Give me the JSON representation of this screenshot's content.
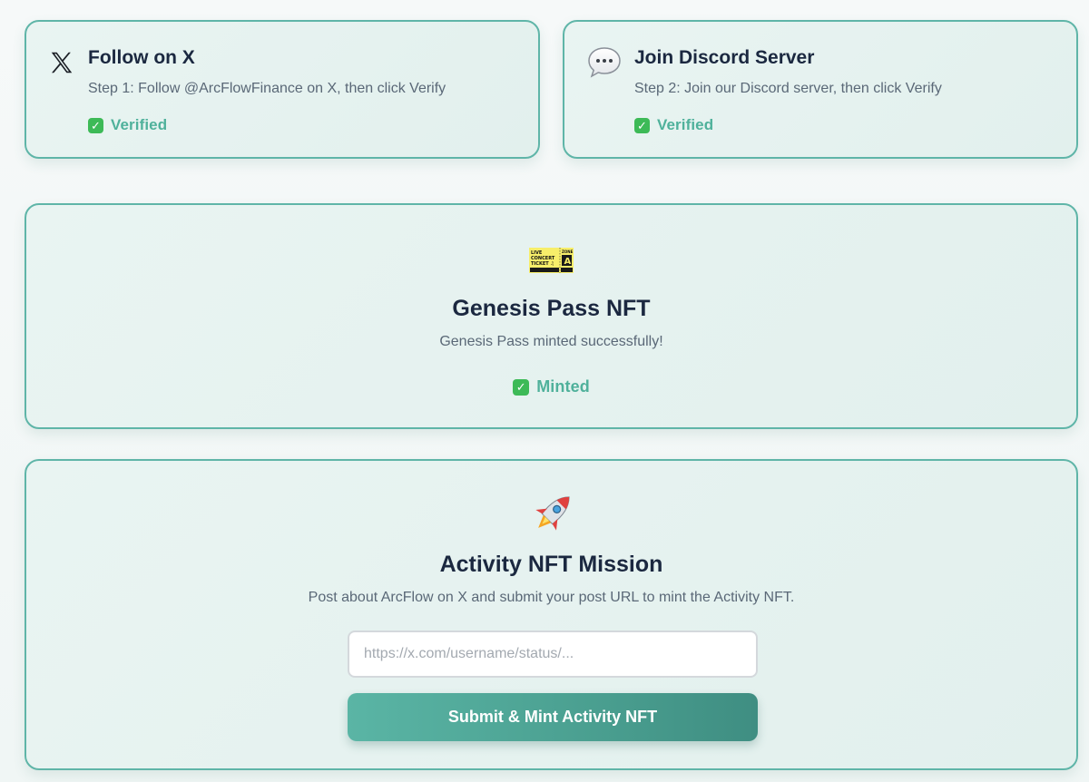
{
  "tasks": [
    {
      "icon": "x-logo-icon",
      "title": "Follow on X",
      "description": "Step 1: Follow @ArcFlowFinance on X, then click Verify",
      "status": "Verified"
    },
    {
      "icon": "speech-bubble-icon",
      "title": "Join Discord Server",
      "description": "Step 2: Join our Discord server, then click Verify",
      "status": "Verified"
    }
  ],
  "genesis": {
    "icon": "ticket-icon",
    "ticket_lines": [
      "LIVE",
      "CONCERT",
      "TICKET ♫",
      "ZONE",
      "A"
    ],
    "title": "Genesis Pass NFT",
    "description": "Genesis Pass minted successfully!",
    "status": "Minted"
  },
  "activity": {
    "icon": "rocket-icon",
    "title": "Activity NFT Mission",
    "description": "Post about ArcFlow on X and submit your post URL to mint the Activity NFT.",
    "input_placeholder": "https://x.com/username/status/...",
    "input_value": "",
    "button_label": "Submit & Mint Activity NFT"
  },
  "colors": {
    "accent": "#5fb5a8",
    "status_green": "#4fb19b",
    "check_green": "#3dba57",
    "title_dark": "#1b2840"
  }
}
